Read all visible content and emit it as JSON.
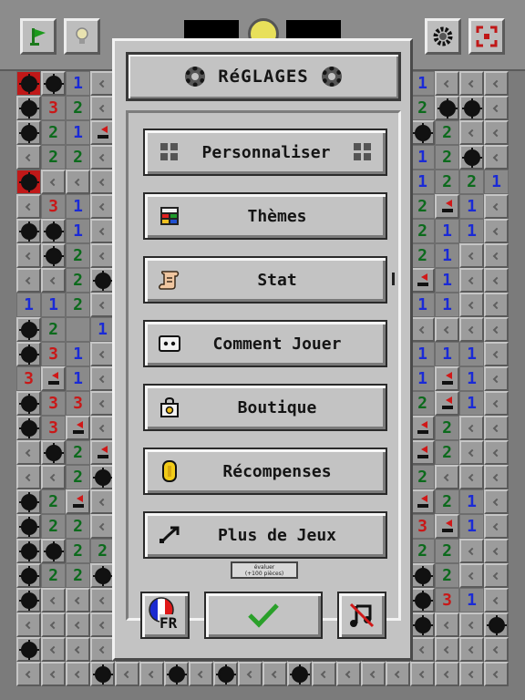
{
  "settings": {
    "title": "RéGLAGES",
    "menu": [
      {
        "label": "Personnaliser",
        "icon": "grid-icon"
      },
      {
        "label": "Thèmes",
        "icon": "palette-icon"
      },
      {
        "label": "Stat",
        "icon": "scroll-icon"
      },
      {
        "label": "Comment Jouer",
        "icon": "controller-icon"
      },
      {
        "label": "Boutique",
        "icon": "shop-bag-icon"
      },
      {
        "label": "Récompenses",
        "icon": "coin-icon"
      },
      {
        "label": "Plus de Jeux",
        "icon": "share-arrow-icon"
      }
    ],
    "evaluate": {
      "line1": "évaluer",
      "line2": "(+100 pièces)"
    },
    "language": "FR"
  },
  "colors": {
    "panel": "#c3c3c3",
    "confirm_check": "#2aa02a",
    "flag_red": "#d01818",
    "num1": "#1a2ad6",
    "num2": "#0c6a1c",
    "num3": "#c81818"
  }
}
